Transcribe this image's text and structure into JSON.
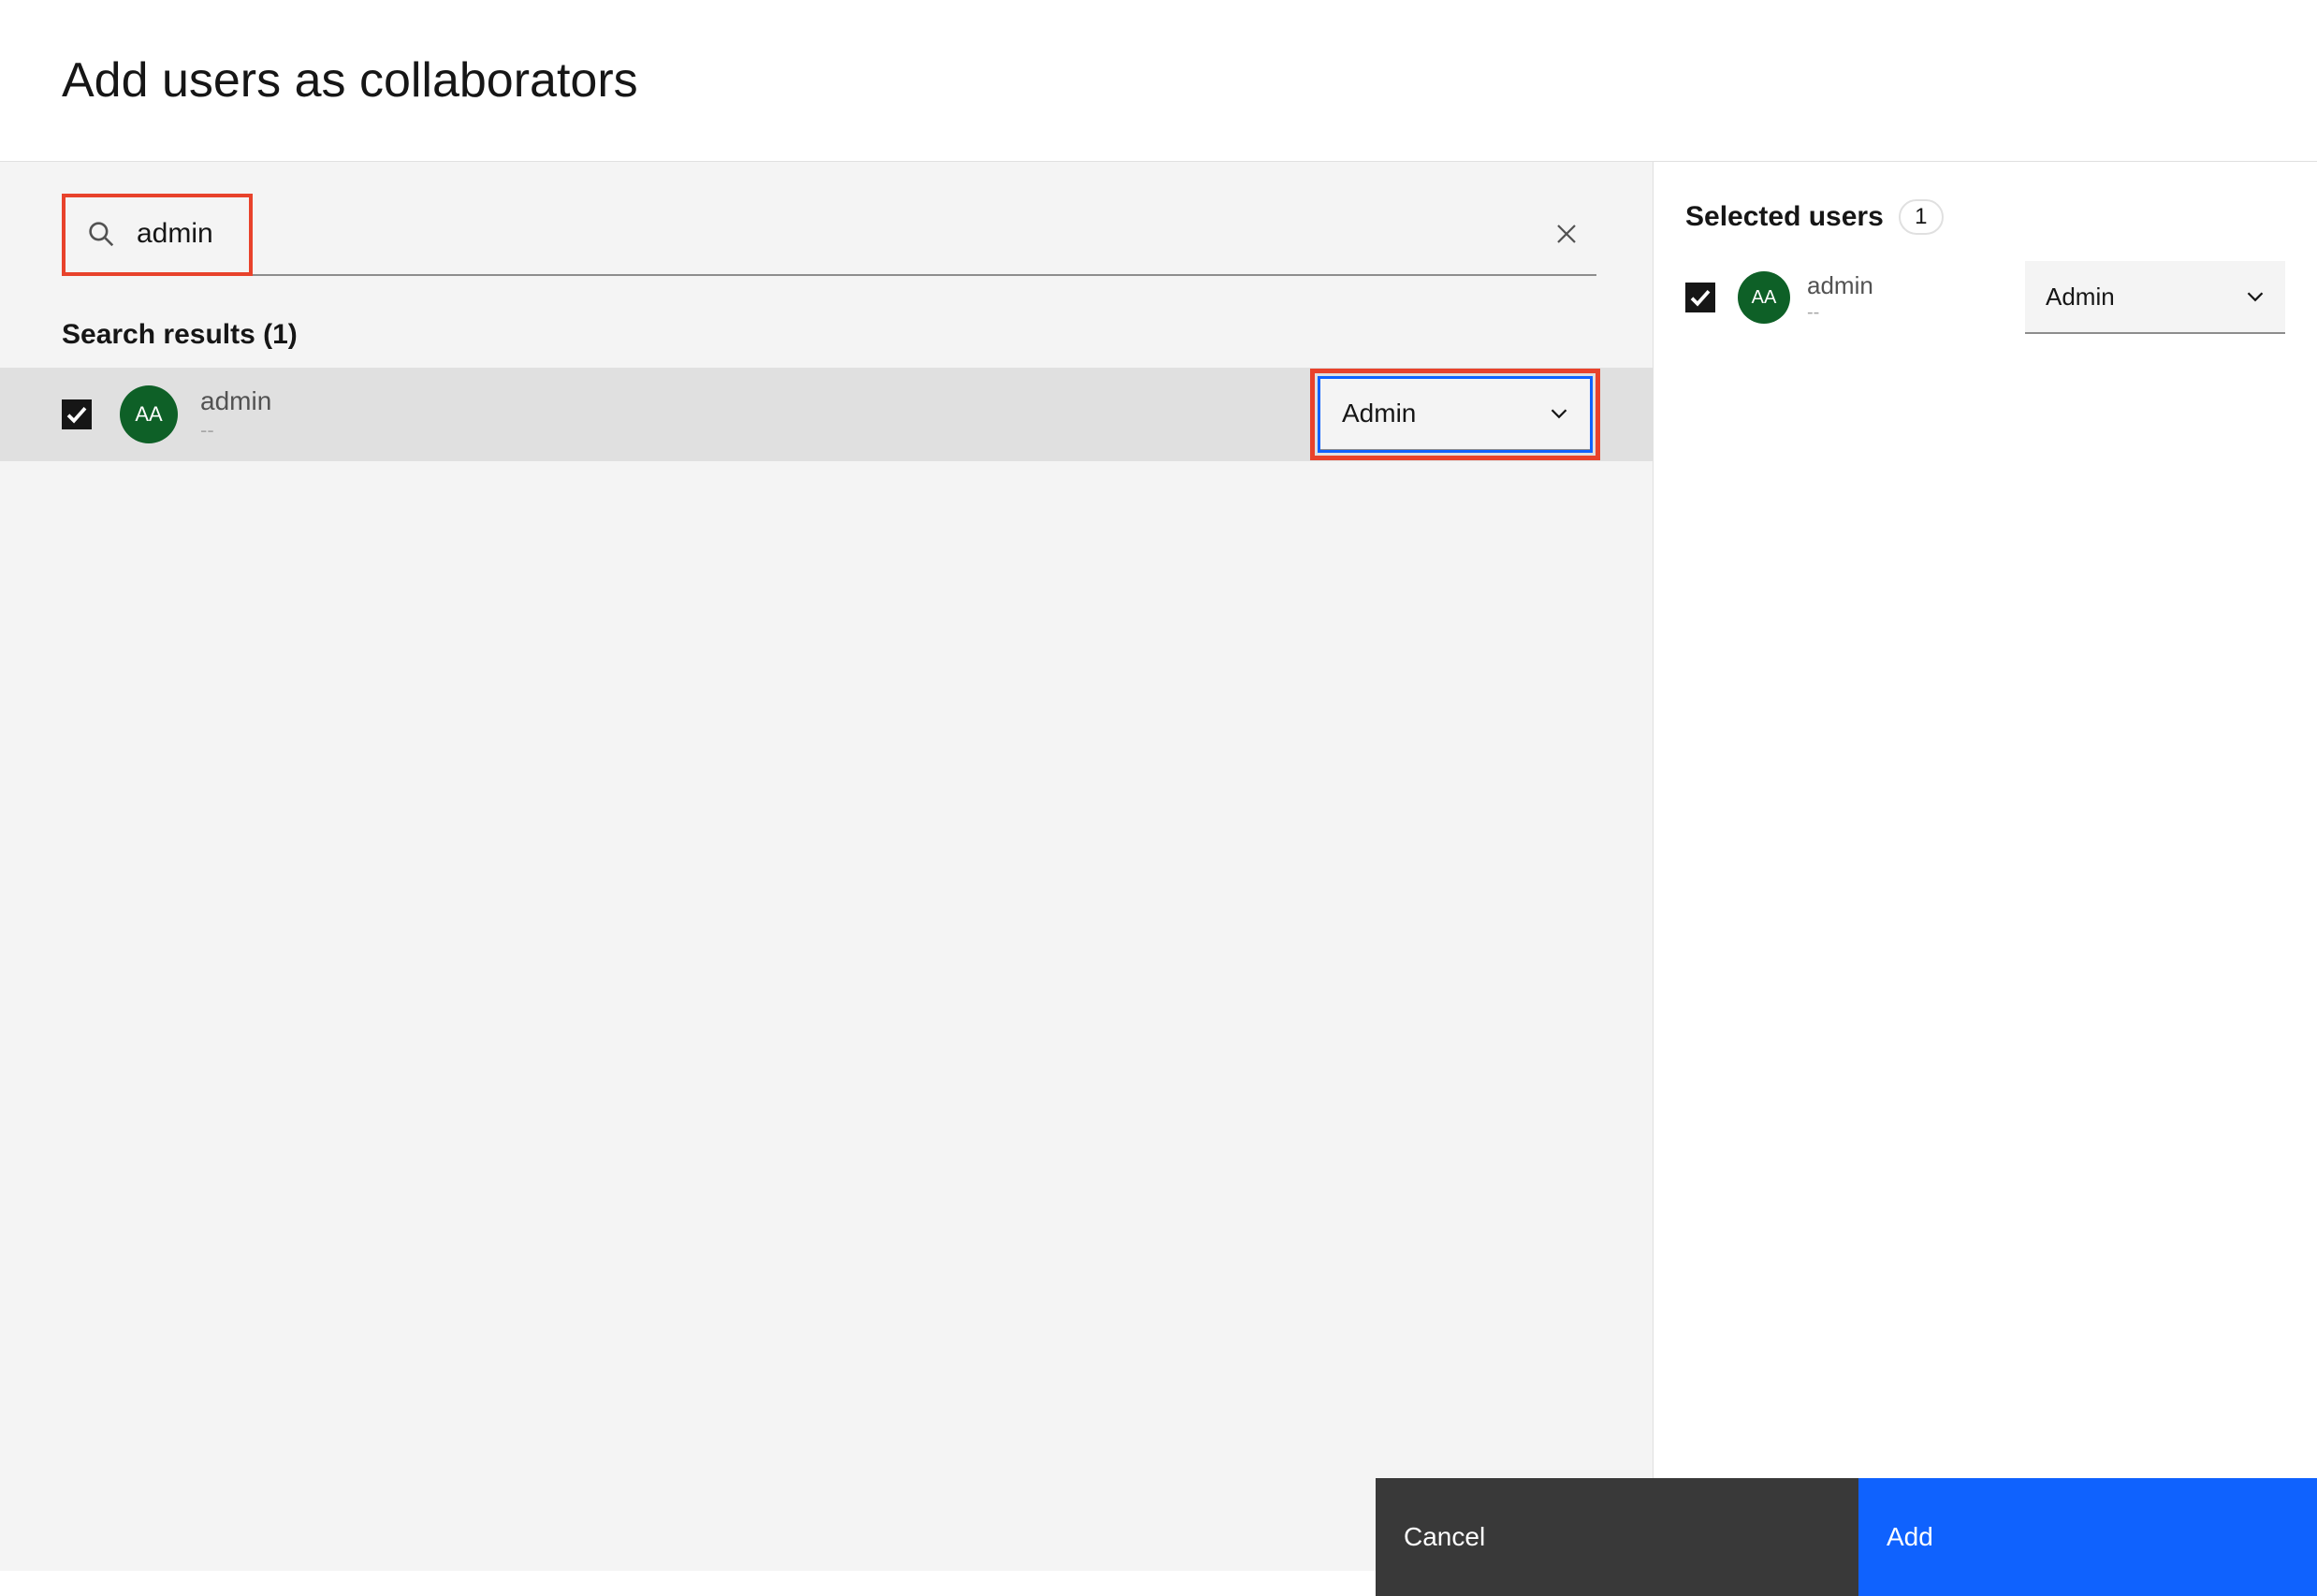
{
  "header": {
    "title": "Add users as collaborators"
  },
  "search": {
    "value": "admin",
    "placeholder": "Search"
  },
  "results": {
    "header": "Search results (1)",
    "items": [
      {
        "checked": true,
        "avatar": "AA",
        "name": "admin",
        "sub": "--",
        "role": "Admin"
      }
    ]
  },
  "selected": {
    "title": "Selected users",
    "count": "1",
    "items": [
      {
        "checked": true,
        "avatar": "AA",
        "name": "admin",
        "sub": "--",
        "role": "Admin"
      }
    ]
  },
  "footer": {
    "cancel": "Cancel",
    "add": "Add"
  },
  "colors": {
    "highlight": "#e8422b",
    "focus": "#0f62fe",
    "avatar": "#0e6027"
  }
}
